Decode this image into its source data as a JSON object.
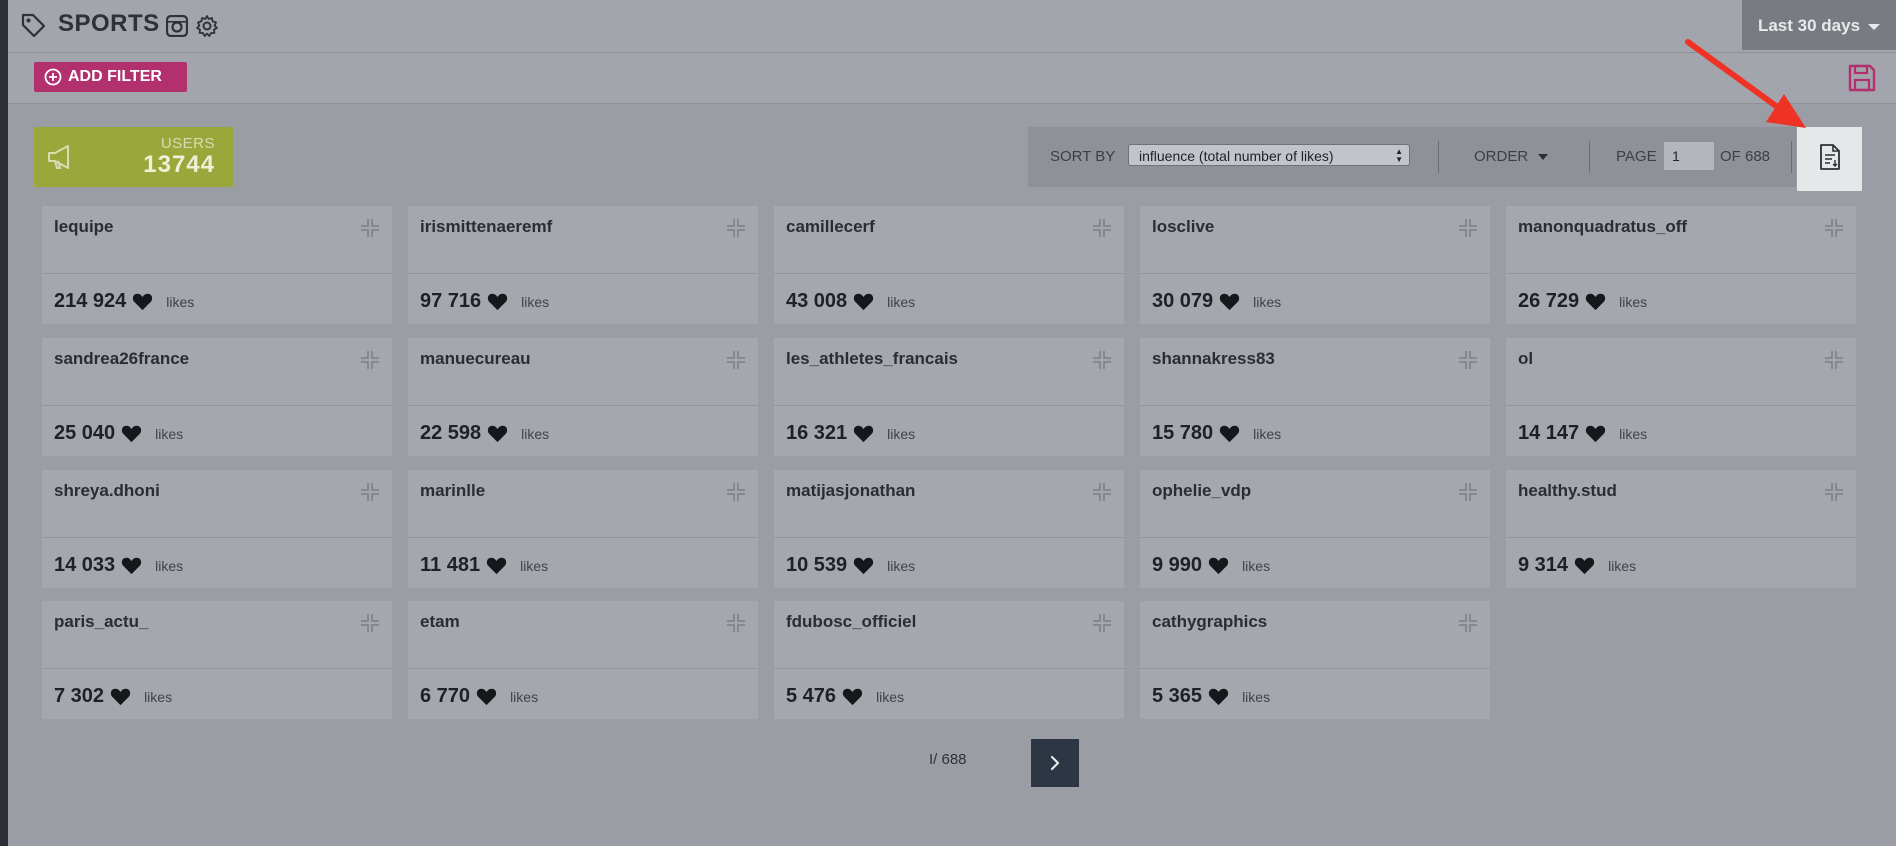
{
  "header": {
    "title": "SPORTS",
    "tag_icon": "tag-icon",
    "instagram_icon": "instagram-icon",
    "settings_icon": "gear-icon",
    "date_range": "Last 30 days"
  },
  "filters": {
    "add_filter_label": "ADD FILTER",
    "add_filter_color": "#b3306f",
    "save_icon": "floppy-disk-icon"
  },
  "stats": {
    "users_label": "USERS",
    "users_count": "13744",
    "icon": "megaphone-icon",
    "color": "#9aa73a"
  },
  "toolbar": {
    "sort_by_label": "SORT BY",
    "sort_selected": "influence (total number of likes)",
    "order_label": "ORDER",
    "page_label": "PAGE",
    "page_value": "1",
    "page_of": "OF 688",
    "export_icon": "export-document-icon"
  },
  "annotation": {
    "arrow_color": "#ee3224"
  },
  "cards": [
    {
      "username": "lequipe",
      "likes": "214 924",
      "unit": "likes"
    },
    {
      "username": "irismittenaeremf",
      "likes": "97 716",
      "unit": "likes"
    },
    {
      "username": "camillecerf",
      "likes": "43 008",
      "unit": "likes"
    },
    {
      "username": "losclive",
      "likes": "30 079",
      "unit": "likes"
    },
    {
      "username": "manonquadratus_off",
      "likes": "26 729",
      "unit": "likes"
    },
    {
      "username": "sandrea26france",
      "likes": "25 040",
      "unit": "likes"
    },
    {
      "username": "manuecureau",
      "likes": "22 598",
      "unit": "likes"
    },
    {
      "username": "les_athletes_francais",
      "likes": "16 321",
      "unit": "likes"
    },
    {
      "username": "shannakress83",
      "likes": "15 780",
      "unit": "likes"
    },
    {
      "username": "ol",
      "likes": "14 147",
      "unit": "likes"
    },
    {
      "username": "shreya.dhoni",
      "likes": "14 033",
      "unit": "likes"
    },
    {
      "username": "marinlle",
      "likes": "11 481",
      "unit": "likes"
    },
    {
      "username": "matijasjonathan",
      "likes": "10 539",
      "unit": "likes"
    },
    {
      "username": "ophelie_vdp",
      "likes": "9 990",
      "unit": "likes"
    },
    {
      "username": "healthy.stud",
      "likes": "9 314",
      "unit": "likes"
    },
    {
      "username": "paris_actu_",
      "likes": "7 302",
      "unit": "likes"
    },
    {
      "username": "etam",
      "likes": "6 770",
      "unit": "likes"
    },
    {
      "username": "fdubosc_officiel",
      "likes": "5 476",
      "unit": "likes"
    },
    {
      "username": "cathygraphics",
      "likes": "5 365",
      "unit": "likes"
    }
  ],
  "pagination": {
    "text": "I/ 688",
    "next_icon": "chevron-right-icon"
  }
}
